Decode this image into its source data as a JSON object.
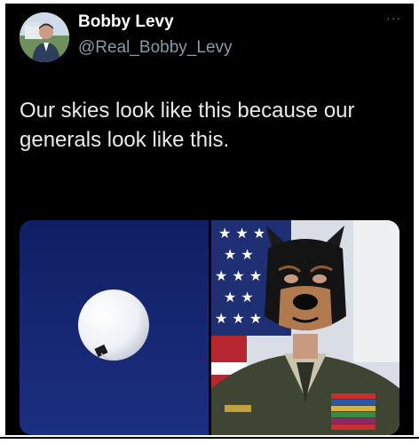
{
  "tweet": {
    "author_name": "Bobby Levy",
    "handle": "@Real_Bobby_Levy",
    "more_label": "···",
    "text": "Our skies look like this because our generals look like this."
  },
  "media": {
    "left_image": "balloon-in-blue-sky",
    "right_image": "general-in-uniform-with-dog-mask"
  },
  "colors": {
    "background": "#000000",
    "name": "#ffffff",
    "handle": "#8b98a5",
    "text": "#e7e9ea"
  }
}
